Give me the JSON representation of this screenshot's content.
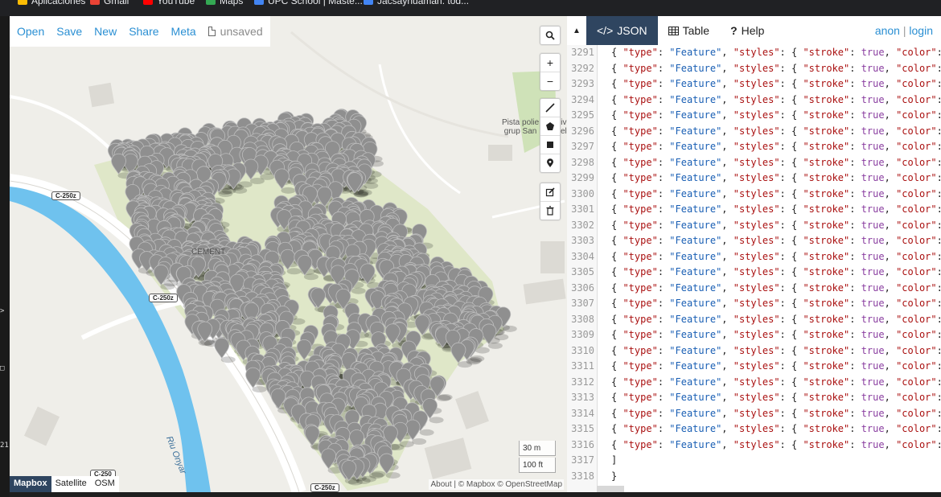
{
  "browser": {
    "bookmarks": [
      {
        "label": "Aplicaciones",
        "icon": "apps-grid-icon",
        "color": "#fbbc04"
      },
      {
        "label": "Gmail",
        "icon": "gmail-icon",
        "color": "#ea4335"
      },
      {
        "label": "YouTube",
        "icon": "youtube-icon",
        "color": "#ff0000"
      },
      {
        "label": "Maps",
        "icon": "maps-pin-icon",
        "color": "#34a853"
      },
      {
        "label": "UPC School | Maste...",
        "icon": "globe-icon",
        "color": "#4285f4"
      },
      {
        "label": "Jacsayhuaman: tod...",
        "icon": "github-icon",
        "color": "#4285f4"
      }
    ]
  },
  "left_edge": {
    "marks": [
      ">",
      "□",
      "21"
    ]
  },
  "map": {
    "menu": {
      "open": "Open",
      "save": "Save",
      "new": "New",
      "share": "Share",
      "meta": "Meta",
      "status": "unsaved"
    },
    "tools": {
      "search": "search-icon",
      "zoom_in": "+",
      "zoom_out": "−"
    },
    "scale": {
      "metric": "30 m",
      "imperial": "100 ft"
    },
    "layers": [
      "Mapbox",
      "Satellite",
      "OSM"
    ],
    "active_layer": "Mapbox",
    "attribution": "About | © Mapbox © OpenStreetMap",
    "road_tags": [
      "C-250z",
      "C-250z",
      "C-250z",
      "C-250"
    ],
    "labels": {
      "cemetery": "CEMENT",
      "sports": "Pista polie",
      "sports2": "grup San",
      "sports_suffix": "iv",
      "sports_suffix2": "el",
      "river": "Riu Onyar"
    }
  },
  "panel": {
    "tabs": [
      {
        "label": "JSON",
        "icon": "code-icon"
      },
      {
        "label": "Table",
        "icon": "table-icon"
      },
      {
        "label": "Help",
        "icon": "help-icon"
      }
    ],
    "active_tab": "JSON",
    "user": {
      "anon": "anon",
      "sep": "|",
      "login": "login"
    },
    "lines": [
      {
        "n": "3291",
        "text": "{ \"type\": \"Feature\", \"styles\": { \"stroke\": true, \"color\":"
      },
      {
        "n": "3292",
        "text": "{ \"type\": \"Feature\", \"styles\": { \"stroke\": true, \"color\":"
      },
      {
        "n": "3293",
        "text": "{ \"type\": \"Feature\", \"styles\": { \"stroke\": true, \"color\":"
      },
      {
        "n": "3294",
        "text": "{ \"type\": \"Feature\", \"styles\": { \"stroke\": true, \"color\":"
      },
      {
        "n": "3295",
        "text": "{ \"type\": \"Feature\", \"styles\": { \"stroke\": true, \"color\":"
      },
      {
        "n": "3296",
        "text": "{ \"type\": \"Feature\", \"styles\": { \"stroke\": true, \"color\":"
      },
      {
        "n": "3297",
        "text": "{ \"type\": \"Feature\", \"styles\": { \"stroke\": true, \"color\":"
      },
      {
        "n": "3298",
        "text": "{ \"type\": \"Feature\", \"styles\": { \"stroke\": true, \"color\":"
      },
      {
        "n": "3299",
        "text": "{ \"type\": \"Feature\", \"styles\": { \"stroke\": true, \"color\":"
      },
      {
        "n": "3300",
        "text": "{ \"type\": \"Feature\", \"styles\": { \"stroke\": true, \"color\":"
      },
      {
        "n": "3301",
        "text": "{ \"type\": \"Feature\", \"styles\": { \"stroke\": true, \"color\":"
      },
      {
        "n": "3302",
        "text": "{ \"type\": \"Feature\", \"styles\": { \"stroke\": true, \"color\":"
      },
      {
        "n": "3303",
        "text": "{ \"type\": \"Feature\", \"styles\": { \"stroke\": true, \"color\":"
      },
      {
        "n": "3304",
        "text": "{ \"type\": \"Feature\", \"styles\": { \"stroke\": true, \"color\":"
      },
      {
        "n": "3305",
        "text": "{ \"type\": \"Feature\", \"styles\": { \"stroke\": true, \"color\":"
      },
      {
        "n": "3306",
        "text": "{ \"type\": \"Feature\", \"styles\": { \"stroke\": true, \"color\":"
      },
      {
        "n": "3307",
        "text": "{ \"type\": \"Feature\", \"styles\": { \"stroke\": true, \"color\":"
      },
      {
        "n": "3308",
        "text": "{ \"type\": \"Feature\", \"styles\": { \"stroke\": true, \"color\":"
      },
      {
        "n": "3309",
        "text": "{ \"type\": \"Feature\", \"styles\": { \"stroke\": true, \"color\":"
      },
      {
        "n": "3310",
        "text": "{ \"type\": \"Feature\", \"styles\": { \"stroke\": true, \"color\":"
      },
      {
        "n": "3311",
        "text": "{ \"type\": \"Feature\", \"styles\": { \"stroke\": true, \"color\":"
      },
      {
        "n": "3312",
        "text": "{ \"type\": \"Feature\", \"styles\": { \"stroke\": true, \"color\":"
      },
      {
        "n": "3313",
        "text": "{ \"type\": \"Feature\", \"styles\": { \"stroke\": true, \"color\":"
      },
      {
        "n": "3314",
        "text": "{ \"type\": \"Feature\", \"styles\": { \"stroke\": true, \"color\":"
      },
      {
        "n": "3315",
        "text": "{ \"type\": \"Feature\", \"styles\": { \"stroke\": true, \"color\":"
      },
      {
        "n": "3316",
        "text": "{ \"type\": \"Feature\", \"styles\": { \"stroke\": true, \"color\":"
      },
      {
        "n": "3317",
        "text": "]"
      },
      {
        "n": "3318",
        "text": "}"
      }
    ]
  },
  "colors": {
    "accent": "#2a8fd3",
    "tab_active": "#2f4560",
    "marker": "#8f8f8f",
    "river": "#6fc2ee",
    "park": "#dfe7c8"
  }
}
